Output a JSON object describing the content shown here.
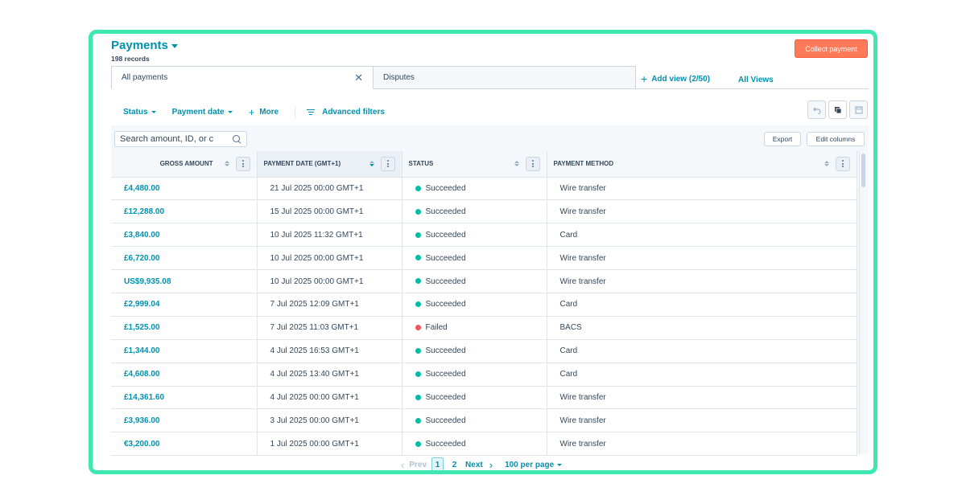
{
  "header": {
    "title": "Payments",
    "record_count": "198 records",
    "collect_button": "Collect payment"
  },
  "views": {
    "tabs": [
      {
        "label": "All payments",
        "active": true
      },
      {
        "label": "Disputes",
        "active": false
      }
    ],
    "add_view": "Add view (2/50)",
    "all_views": "All Views"
  },
  "filters": {
    "status": "Status",
    "payment_date": "Payment date",
    "more": "More",
    "advanced": "Advanced filters"
  },
  "toolbar": {
    "undo_icon": "undo-icon",
    "clone_icon": "copy-icon",
    "save_icon": "save-icon"
  },
  "table": {
    "search_placeholder": "Search amount, ID, or c",
    "export_label": "Export",
    "edit_columns_label": "Edit columns",
    "columns": [
      "Gross amount",
      "Payment date (GMT+1)",
      "Status",
      "Payment method"
    ],
    "rows": [
      {
        "amount": "£4,480.00",
        "date": "21 Jul 2025 00:00 GMT+1",
        "status": "Succeeded",
        "method": "Wire transfer"
      },
      {
        "amount": "£12,288.00",
        "date": "15 Jul 2025 00:00 GMT+1",
        "status": "Succeeded",
        "method": "Wire transfer"
      },
      {
        "amount": "£3,840.00",
        "date": "10 Jul 2025 11:32 GMT+1",
        "status": "Succeeded",
        "method": "Card"
      },
      {
        "amount": "£6,720.00",
        "date": "10 Jul 2025 00:00 GMT+1",
        "status": "Succeeded",
        "method": "Wire transfer"
      },
      {
        "amount": "US$9,935.08",
        "date": "10 Jul 2025 00:00 GMT+1",
        "status": "Succeeded",
        "method": "Wire transfer"
      },
      {
        "amount": "£2,999.04",
        "date": "7 Jul 2025 12:09 GMT+1",
        "status": "Succeeded",
        "method": "Card"
      },
      {
        "amount": "£1,525.00",
        "date": "7 Jul 2025 11:03 GMT+1",
        "status": "Failed",
        "method": "BACS"
      },
      {
        "amount": "£1,344.00",
        "date": "4 Jul 2025 16:53 GMT+1",
        "status": "Succeeded",
        "method": "Card"
      },
      {
        "amount": "£4,608.00",
        "date": "4 Jul 2025 13:40 GMT+1",
        "status": "Succeeded",
        "method": "Card"
      },
      {
        "amount": "£14,361.60",
        "date": "4 Jul 2025 00:00 GMT+1",
        "status": "Succeeded",
        "method": "Wire transfer"
      },
      {
        "amount": "£3,936.00",
        "date": "3 Jul 2025 00:00 GMT+1",
        "status": "Succeeded",
        "method": "Wire transfer"
      },
      {
        "amount": "€3,200.00",
        "date": "1 Jul 2025 00:00 GMT+1",
        "status": "Succeeded",
        "method": "Wire transfer"
      }
    ]
  },
  "pagination": {
    "prev": "Prev",
    "pages": [
      "1",
      "2"
    ],
    "current_page": "1",
    "next": "Next",
    "per_page": "100 per page"
  },
  "colors": {
    "frame_border": "#3ee8b0",
    "link": "#0091ae",
    "primary_button": "#ff7a59",
    "success": "#00bda5",
    "failed": "#f2545b"
  }
}
